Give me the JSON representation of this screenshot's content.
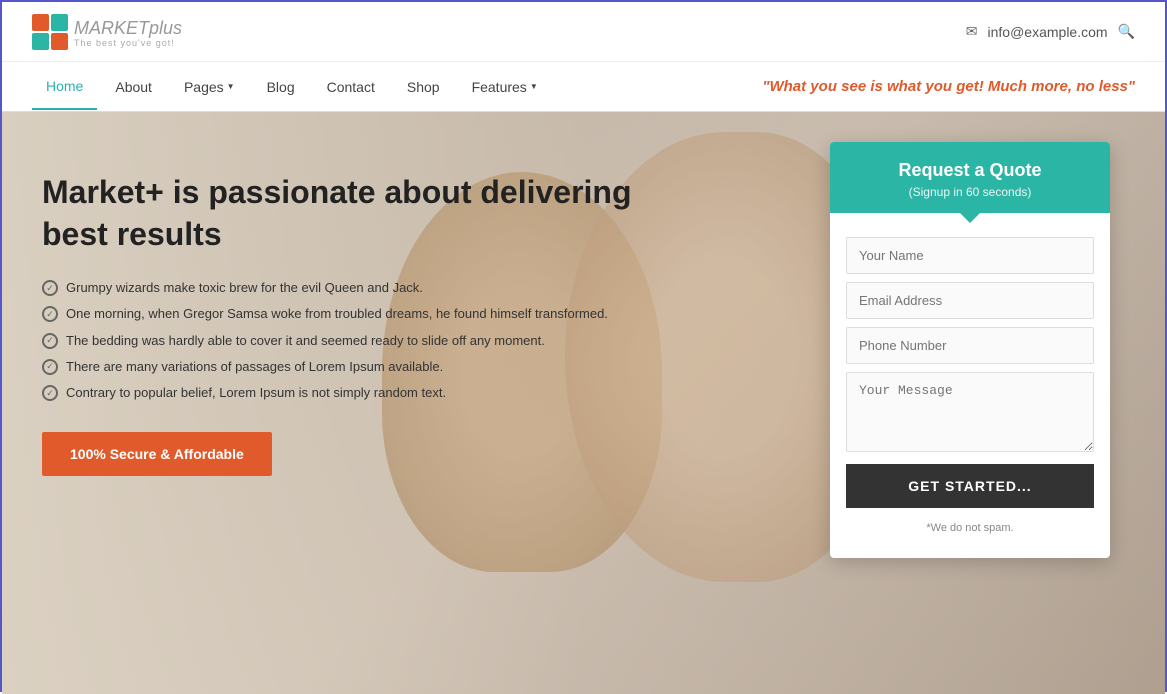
{
  "topbar": {
    "email": "info@example.com",
    "search_icon": "search-icon"
  },
  "logo": {
    "main": "MARKET",
    "suffix": "plus",
    "sub": "The best you've got!"
  },
  "nav": {
    "items": [
      {
        "label": "Home",
        "active": true,
        "has_arrow": false
      },
      {
        "label": "About",
        "active": false,
        "has_arrow": false
      },
      {
        "label": "Pages",
        "active": false,
        "has_arrow": true
      },
      {
        "label": "Blog",
        "active": false,
        "has_arrow": false
      },
      {
        "label": "Contact",
        "active": false,
        "has_arrow": false
      },
      {
        "label": "Shop",
        "active": false,
        "has_arrow": false
      },
      {
        "label": "Features",
        "active": false,
        "has_arrow": true
      }
    ],
    "tagline": "\"What you see is what you get! Much more, no less\""
  },
  "hero": {
    "title": "Market+ is passionate about delivering best results",
    "list_items": [
      "Grumpy wizards make toxic brew for the evil Queen and Jack.",
      "One morning, when Gregor Samsa woke from troubled dreams, he found himself transformed.",
      "The bedding was hardly able to cover it and seemed ready to slide off any moment.",
      "There are many variations of passages of Lorem Ipsum available.",
      "Contrary to popular belief, Lorem Ipsum is not simply random text."
    ],
    "cta_label": "100% Secure & Affordable"
  },
  "quote_form": {
    "header_title": "Request a Quote",
    "header_sub": "(Signup in 60 seconds)",
    "name_placeholder": "Your Name",
    "email_placeholder": "Email Address",
    "phone_placeholder": "Phone Number",
    "message_placeholder": "Your Message",
    "submit_label": "GET STARTED...",
    "spam_note": "*We do not spam."
  },
  "colors": {
    "accent_teal": "#2ab5a5",
    "accent_orange": "#e05a2b",
    "nav_active": "#2ab0b0"
  }
}
